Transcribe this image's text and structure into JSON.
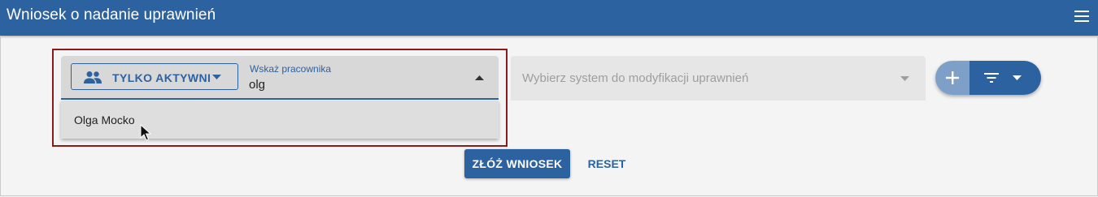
{
  "app_bar": {
    "title": "Wniosek o nadanie uprawnień",
    "menu_icon": "hamburger-menu-icon"
  },
  "employee_filter": {
    "toggle_label": "TYLKO AKTYWNI",
    "toggle_icon": "people-icon",
    "field_label": "Wskaż pracownika",
    "field_value": "olg",
    "expanded": true,
    "options": [
      {
        "label": "Olga Mocko"
      }
    ]
  },
  "system_select": {
    "placeholder": "Wybierz system do modyfikacji uprawnień"
  },
  "actions": {
    "add_icon": "plus-icon",
    "filter_icon": "filter-icon"
  },
  "footer": {
    "submit_label": "ZŁÓŻ WNIOSEK",
    "reset_label": "RESET"
  },
  "colors": {
    "primary": "#2d62a0",
    "highlight": "#8b1a1a",
    "background": "#f4f4f4"
  }
}
